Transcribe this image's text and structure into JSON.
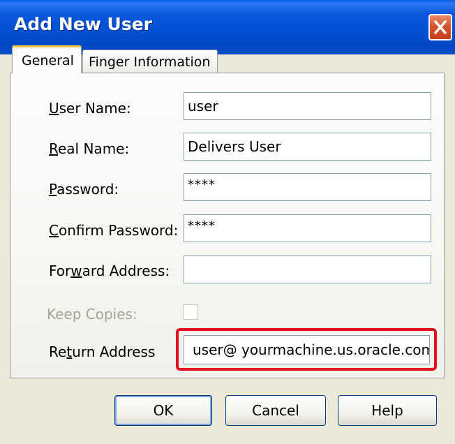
{
  "window": {
    "title": "Add New User"
  },
  "tabs": [
    {
      "label": "General",
      "selected": true
    },
    {
      "label": "Finger Information",
      "selected": false
    }
  ],
  "form": {
    "user_name": {
      "pre": "",
      "key": "U",
      "post": "ser Name:",
      "value": "user"
    },
    "real_name": {
      "pre": "",
      "key": "R",
      "post": "eal Name:",
      "value": "Delivers User"
    },
    "password": {
      "pre": "",
      "key": "P",
      "post": "assword:",
      "value": "****"
    },
    "confirm_password": {
      "pre": "",
      "key": "C",
      "post": "onfirm Password:",
      "value": "****"
    },
    "forward_address": {
      "pre": "For",
      "key": "w",
      "post": "ard Address:",
      "value": ""
    },
    "keep_copies": {
      "label": "Keep Copies:",
      "checked": false,
      "enabled": false
    },
    "return_address": {
      "pre": "Re",
      "key": "t",
      "post": "urn Address",
      "value": "user@ yourmachine.us.oracle.com"
    }
  },
  "buttons": {
    "ok": "OK",
    "cancel": "Cancel",
    "help": "Help"
  },
  "icons": {
    "close": "close-icon"
  },
  "colors": {
    "titlebar": "#0450d2",
    "close": "#d5542f",
    "highlight": "#e0101e",
    "tab_accent": "#ffc83c"
  }
}
